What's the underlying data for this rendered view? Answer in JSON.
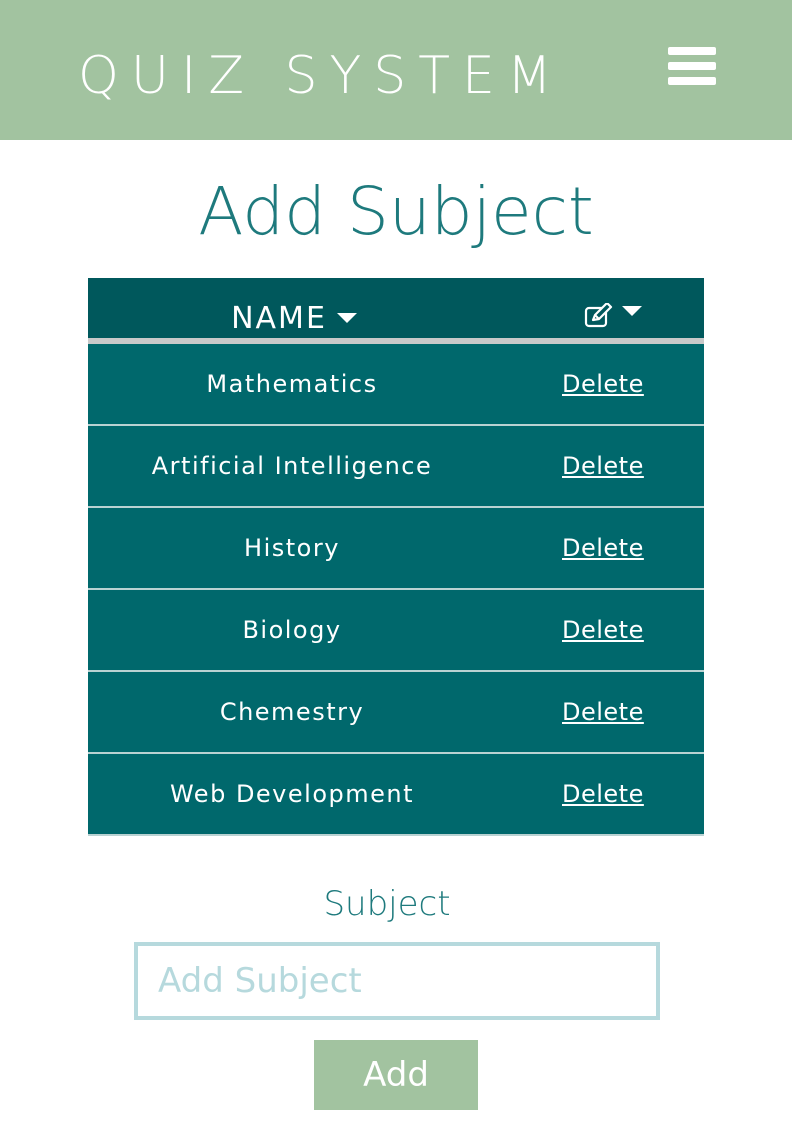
{
  "header": {
    "brand": "QUIZ SYSTEM",
    "menu_icon": "hamburger-menu-icon",
    "background": "#a2c3a0"
  },
  "page": {
    "title": "Add Subject",
    "title_color": "#1e7a7d"
  },
  "table": {
    "columns": [
      {
        "label": "NAME",
        "icon": "sort-caret-icon"
      },
      {
        "label": "",
        "icon": "edit-icon"
      }
    ],
    "rows": [
      {
        "name": "Mathematics",
        "action": "Delete"
      },
      {
        "name": "Artificial Intelligence",
        "action": "Delete"
      },
      {
        "name": "History",
        "action": "Delete"
      },
      {
        "name": "Biology",
        "action": "Delete"
      },
      {
        "name": "Chemestry",
        "action": "Delete"
      },
      {
        "name": "Web Development",
        "action": "Delete"
      }
    ],
    "header_color": "#00585c",
    "row_color": "#00686c"
  },
  "form": {
    "label": "Subject",
    "input_placeholder": "Add Subject",
    "input_value": "",
    "submit_label": "Add"
  }
}
